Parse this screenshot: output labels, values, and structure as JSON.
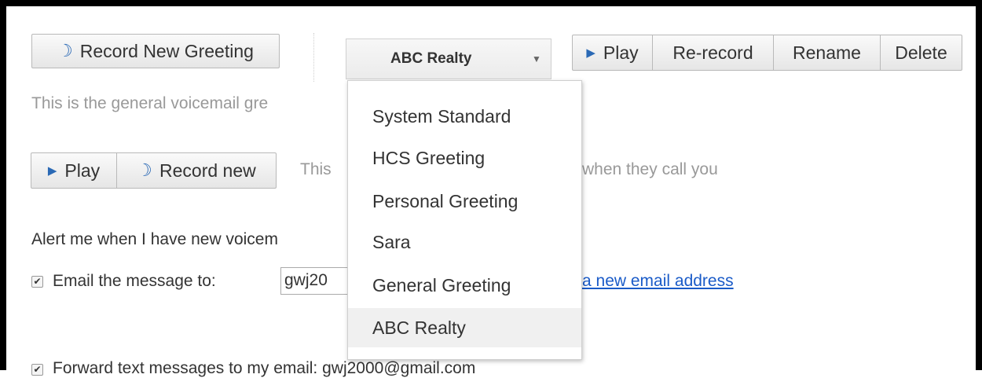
{
  "greeting_toolbar": {
    "record_new_greeting": "Record New Greeting",
    "selected_greeting": "ABC Realty",
    "play": "Play",
    "re_record": "Re-record",
    "rename": "Rename",
    "delete": "Delete"
  },
  "greeting_description": "This is the general voicemail gre",
  "name_toolbar": {
    "play": "Play",
    "record_new": "Record new",
    "description_left": "This",
    "description_right": "when they call you"
  },
  "dropdown_menu": {
    "items": [
      {
        "label": "System Standard"
      },
      {
        "label": "HCS Greeting"
      },
      {
        "label": "Personal Greeting"
      },
      {
        "label": "Sara"
      },
      {
        "label": "General Greeting"
      },
      {
        "label": "ABC Realty"
      }
    ],
    "selected_index": 5
  },
  "alerts": {
    "heading": "Alert me when I have new voicem",
    "email_label": "Email the message to:",
    "email_value": "gwj20",
    "add_email_link": "a new email address",
    "forward_text": "Forward text messages to my email: gwj2000@gmail.com"
  },
  "icons": {
    "phone": "phone-icon",
    "play": "play-icon",
    "caret": "caret-down-icon",
    "check": "checkmark-icon"
  },
  "colors": {
    "accent_blue": "#2a69b5",
    "link_blue": "#1a5bc8",
    "muted_text": "#999999",
    "menu_active": "#f0f0f0"
  }
}
